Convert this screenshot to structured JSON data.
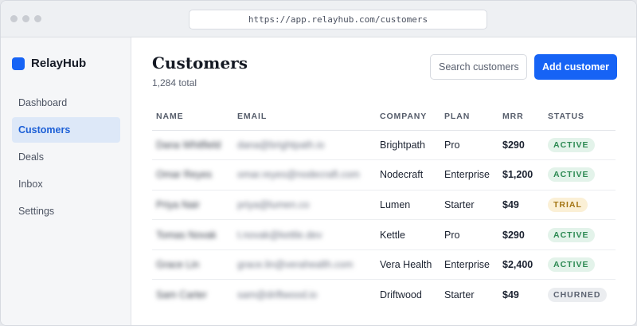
{
  "browser": {
    "url": "https://app.relayhub.com/customers"
  },
  "sidebar": {
    "brand": "RelayHub",
    "items": [
      {
        "label": "Dashboard",
        "active": false
      },
      {
        "label": "Customers",
        "active": true
      },
      {
        "label": "Deals",
        "active": false
      },
      {
        "label": "Inbox",
        "active": false
      },
      {
        "label": "Settings",
        "active": false
      }
    ]
  },
  "main": {
    "title": "Customers",
    "subtitle": "1,284 total",
    "search_placeholder": "Search customers",
    "add_label": "Add customer"
  },
  "table": {
    "columns": [
      "NAME",
      "EMAIL",
      "COMPANY",
      "PLAN",
      "MRR",
      "STATUS"
    ],
    "rows": [
      {
        "name": "Dana Whitfield",
        "email": "dana@brightpath.io",
        "company": "Brightpath",
        "plan": "Pro",
        "mrr": "$290",
        "status": "ACTIVE"
      },
      {
        "name": "Omar Reyes",
        "email": "omar.reyes@nodecraft.com",
        "company": "Nodecraft",
        "plan": "Enterprise",
        "mrr": "$1,200",
        "status": "ACTIVE"
      },
      {
        "name": "Priya Nair",
        "email": "priya@lumen.co",
        "company": "Lumen",
        "plan": "Starter",
        "mrr": "$49",
        "status": "TRIAL"
      },
      {
        "name": "Tomas Novak",
        "email": "t.novak@kettle.dev",
        "company": "Kettle",
        "plan": "Pro",
        "mrr": "$290",
        "status": "ACTIVE"
      },
      {
        "name": "Grace Lin",
        "email": "grace.lin@verahealth.com",
        "company": "Vera Health",
        "plan": "Enterprise",
        "mrr": "$2,400",
        "status": "ACTIVE"
      },
      {
        "name": "Sam Carter",
        "email": "sam@driftwood.io",
        "company": "Driftwood",
        "plan": "Starter",
        "mrr": "$49",
        "status": "CHURNED"
      }
    ]
  },
  "colors": {
    "accent": "#1663f5",
    "active_bg": "#e3f3ea",
    "active_fg": "#2d8a53",
    "trial_bg": "#fbf0d6",
    "trial_fg": "#a37514",
    "churned_bg": "#ebedf0",
    "churned_fg": "#5b6270"
  }
}
